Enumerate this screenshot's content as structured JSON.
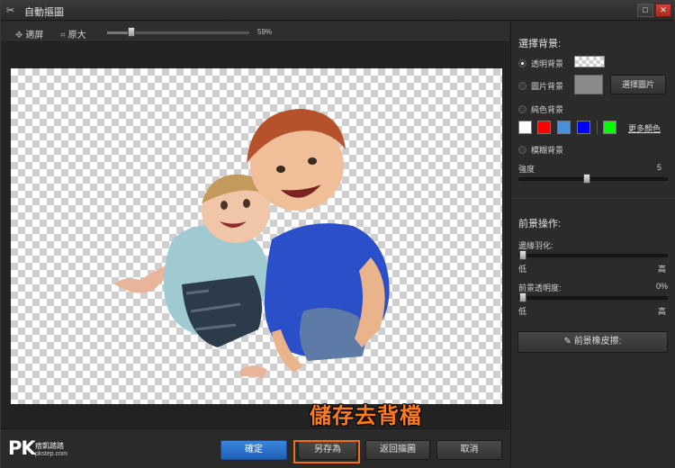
{
  "window": {
    "title": "自動摳圖",
    "title_icon": "scissors-icon",
    "max_icon": "maximize-icon",
    "close_icon": "close-icon",
    "close_glyph": "✕",
    "max_glyph": "□"
  },
  "toolbar": {
    "fit_label": "適屏",
    "zoom_label": "原大",
    "zoom_value": 59,
    "zoom_text": "59%"
  },
  "overlay": {
    "annotation": "儲存去背檔"
  },
  "footer": {
    "logo": {
      "mark": "PK",
      "name": "痞凱踏踏",
      "site": "pkstep.com"
    },
    "ok_label": "確定",
    "saveas_label": "另存為",
    "restore_label": "返回摳圖",
    "cancel_label": "取消"
  },
  "panel": {
    "bg_title": "選擇背景:",
    "transparent_label": "透明背景",
    "image_label": "圖片背景",
    "choose_image_label": "選擇圖片",
    "solid_label": "純色背景",
    "colors": [
      "#ffffff",
      "#ff0000",
      "#4a90d9",
      "#0000ff",
      "#00ff00"
    ],
    "more_colors_label": "更多顏色",
    "blur_label": "模糊背景",
    "strength_label": "強度",
    "strength_value": "5",
    "strength_level": 0.45,
    "fg_title": "前景操作:",
    "feather_label": "邊緣羽化:",
    "feather_low": "低",
    "feather_high": "高",
    "opacity_label": "前景透明度:",
    "opacity_value": "0%",
    "opacity_low": "低",
    "opacity_high": "高",
    "restore_fg_label": "前景橡皮擦:",
    "selected_background": "transparent"
  }
}
